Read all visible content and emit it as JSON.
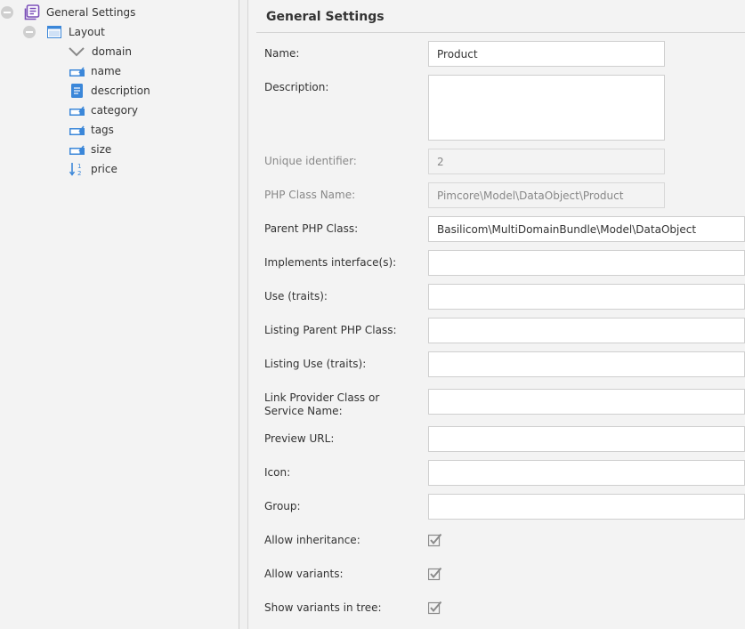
{
  "tree": {
    "root": {
      "label": "General Settings",
      "icon": "class-settings-icon"
    },
    "layout": {
      "label": "Layout",
      "icon": "panel-layout-icon"
    },
    "fields": [
      {
        "label": "domain",
        "icon": "select-chevron-icon"
      },
      {
        "label": "name",
        "icon": "input-field-icon"
      },
      {
        "label": "description",
        "icon": "textarea-document-icon"
      },
      {
        "label": "category",
        "icon": "input-field-icon"
      },
      {
        "label": "tags",
        "icon": "input-field-icon"
      },
      {
        "label": "size",
        "icon": "input-field-icon"
      },
      {
        "label": "price",
        "icon": "numeric-field-icon"
      }
    ]
  },
  "form": {
    "title": "General Settings",
    "name": {
      "label": "Name:",
      "value": "Product"
    },
    "description": {
      "label": "Description:",
      "value": ""
    },
    "unique_identifier": {
      "label": "Unique identifier:",
      "value": "2"
    },
    "php_class_name": {
      "label": "PHP Class Name:",
      "value": "Pimcore\\Model\\DataObject\\Product"
    },
    "parent_php_class": {
      "label": "Parent PHP Class:",
      "value": "Basilicom\\MultiDomainBundle\\Model\\DataObject"
    },
    "implements_interfaces": {
      "label": "Implements interface(s):",
      "value": ""
    },
    "use_traits": {
      "label": "Use (traits):",
      "value": ""
    },
    "listing_parent_php_class": {
      "label": "Listing Parent PHP Class:",
      "value": ""
    },
    "listing_use_traits": {
      "label": "Listing Use (traits):",
      "value": ""
    },
    "link_provider": {
      "label": "Link Provider Class or Service Name:",
      "value": ""
    },
    "preview_url": {
      "label": "Preview URL:",
      "value": ""
    },
    "icon": {
      "label": "Icon:",
      "value": ""
    },
    "group": {
      "label": "Group:",
      "value": ""
    },
    "allow_inheritance": {
      "label": "Allow inheritance:",
      "checked": true
    },
    "allow_variants": {
      "label": "Allow variants:",
      "checked": true
    },
    "show_variants_in_tree": {
      "label": "Show variants in tree:",
      "checked": true
    }
  },
  "colors": {
    "accent_purple": "#7b4fb8",
    "accent_blue": "#3b87d9",
    "checkbox_gray": "#8a8a8a"
  }
}
